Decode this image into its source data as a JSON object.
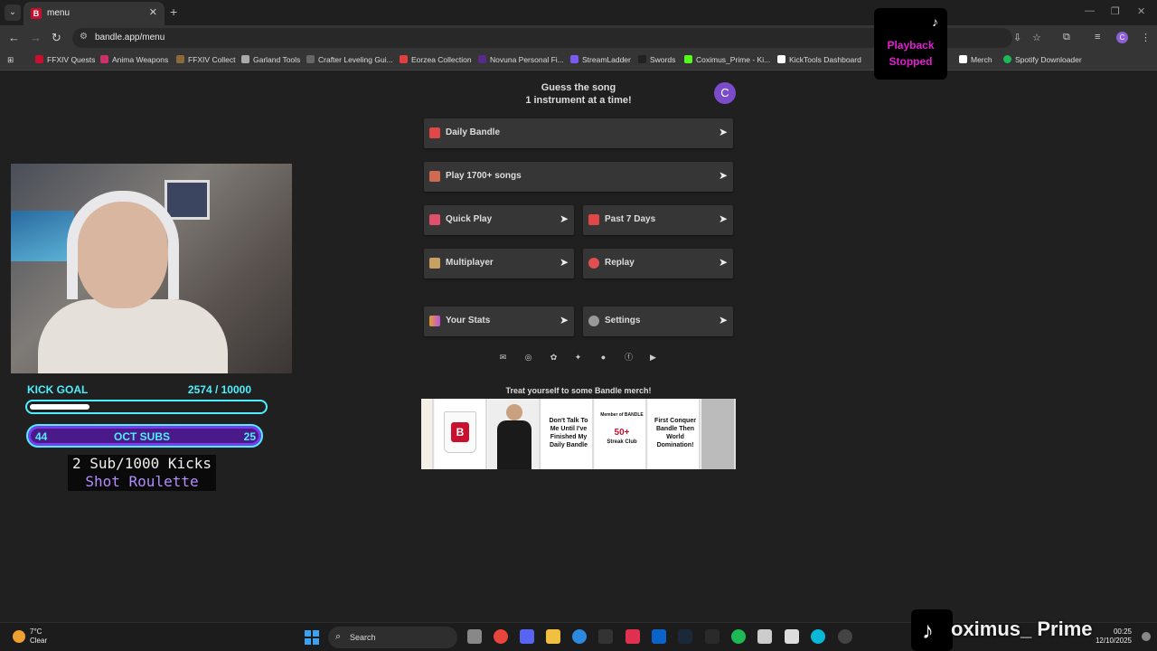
{
  "browser": {
    "tab_title": "menu",
    "url": "bandle.app/menu",
    "profile_initial": "C",
    "bookmarks": [
      {
        "label": "FFXIV Quests",
        "color": "#c8102e"
      },
      {
        "label": "Anima Weapons",
        "color": "#d0306a"
      },
      {
        "label": "FFXIV Collect",
        "color": "#8a6a3a"
      },
      {
        "label": "Garland Tools",
        "color": "#aaaaaa"
      },
      {
        "label": "Crafter Leveling Gui...",
        "color": "#666666"
      },
      {
        "label": "Eorzea Collection",
        "color": "#e04040"
      },
      {
        "label": "Novuna Personal Fi...",
        "color": "#5a2a8a"
      },
      {
        "label": "StreamLadder",
        "color": "#7a5af0"
      },
      {
        "label": "Swords",
        "color": "#222222"
      },
      {
        "label": "Coximus_Prime - Ki...",
        "color": "#53fc18"
      },
      {
        "label": "KickTools Dashboard",
        "color": "#ffffff"
      },
      {
        "label": "Merch",
        "color": "#ffffff"
      },
      {
        "label": "Spotify Downloader",
        "color": "#1db954"
      }
    ]
  },
  "overlay": {
    "playback_line1": "Playback",
    "playback_line2": "Stopped",
    "kick_goal_label": "KICK GOAL",
    "kick_goal_value": "2574  / 10000",
    "kick_goal_progress": 0.2574,
    "subs_left": "44",
    "subs_label": "OCT SUBS",
    "subs_right": "25",
    "roulette_line1": "2 Sub/1000 Kicks",
    "roulette_line2": "Shot Roulette",
    "stream_name": "oximus_ Prime"
  },
  "page": {
    "tagline_line1": "Guess the song",
    "tagline_line2": "1 instrument at a time!",
    "avatar_initial": "C",
    "menu": [
      {
        "label": "Daily Bandle",
        "icon_color": "#e04848"
      },
      {
        "label": "Play 1700+ songs",
        "icon_color": "#d06a50"
      },
      {
        "label": "Quick Play",
        "icon_color": "#e0506a"
      },
      {
        "label": "Past 7 Days",
        "icon_color": "#e04848"
      },
      {
        "label": "Multiplayer",
        "icon_color": "#c8a060"
      },
      {
        "label": "Replay",
        "icon_color": "#e05050"
      },
      {
        "label": "Your Stats",
        "icon_color": "#c050e0"
      },
      {
        "label": "Settings",
        "icon_color": "#999999"
      }
    ],
    "arrow": "➤",
    "merch_title": "Treat yourself to some Bandle merch!",
    "merch_texts": {
      "item3": "Don't Talk To Me Until I've Finished My Daily Bandle",
      "item4_top": "Member of BANDLE",
      "item4_mid": "50+",
      "item4_bottom": "Streak Club",
      "item5": "First Conquer Bandle Then World Domination!"
    }
  },
  "taskbar": {
    "temp": "7°C",
    "condition": "Clear",
    "search_label": "Search",
    "time": "00:25",
    "date": "12/10/2025"
  }
}
